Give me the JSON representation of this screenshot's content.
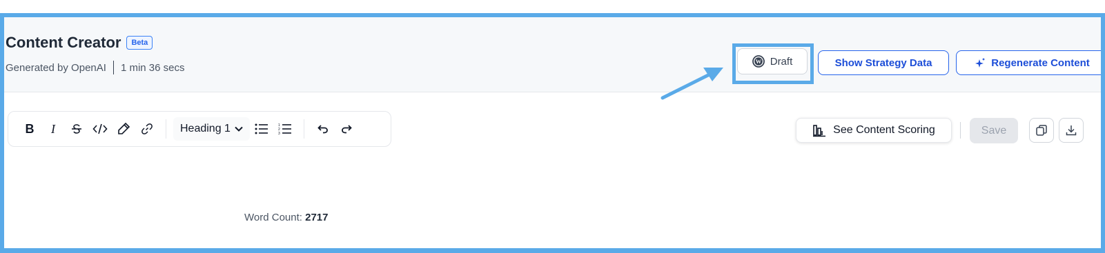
{
  "header": {
    "title": "Content Creator",
    "badge": "Beta",
    "generated_by": "Generated by OpenAI",
    "duration": "1 min 36 secs"
  },
  "actions": {
    "draft_label": "Draft",
    "strategy_label": "Show Strategy Data",
    "regenerate_label": "Regenerate Content"
  },
  "toolbar": {
    "heading_select_value": "Heading 1",
    "buttons": [
      "bold-icon",
      "italic-icon",
      "strikethrough-icon",
      "code-icon",
      "highlight-icon",
      "link-icon",
      "bullet-list-icon",
      "numbered-list-icon",
      "undo-icon",
      "redo-icon"
    ]
  },
  "editor_actions": {
    "scoring_label": "See Content Scoring",
    "save_label": "Save"
  },
  "footer": {
    "word_count_label": "Word Count:",
    "word_count_value": "2717"
  },
  "colors": {
    "annotation": "#5aaae8",
    "primary": "#2563eb",
    "header_bg": "#f6f8fa"
  }
}
